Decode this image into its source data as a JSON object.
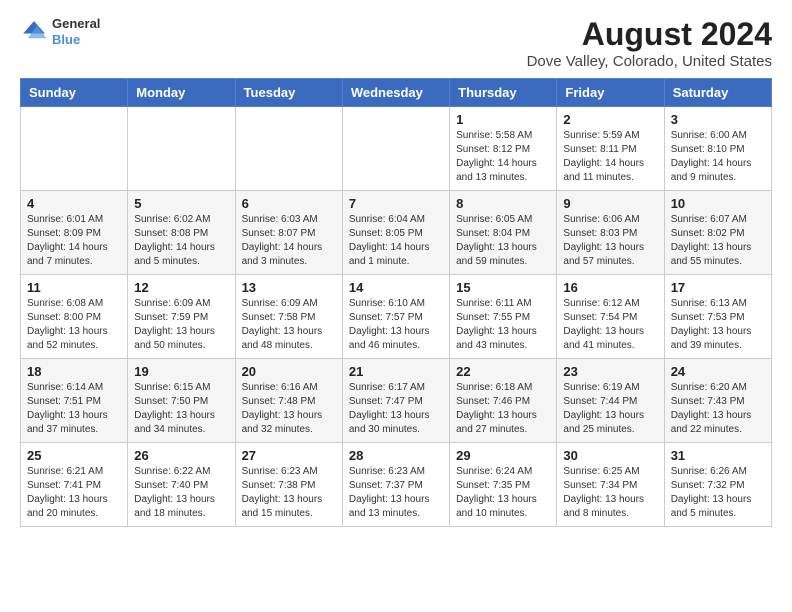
{
  "logo": {
    "general": "General",
    "blue": "Blue"
  },
  "title": "August 2024",
  "subtitle": "Dove Valley, Colorado, United States",
  "days_of_week": [
    "Sunday",
    "Monday",
    "Tuesday",
    "Wednesday",
    "Thursday",
    "Friday",
    "Saturday"
  ],
  "weeks": [
    [
      {
        "day": "",
        "content": ""
      },
      {
        "day": "",
        "content": ""
      },
      {
        "day": "",
        "content": ""
      },
      {
        "day": "",
        "content": ""
      },
      {
        "day": "1",
        "content": "Sunrise: 5:58 AM\nSunset: 8:12 PM\nDaylight: 14 hours and 13 minutes."
      },
      {
        "day": "2",
        "content": "Sunrise: 5:59 AM\nSunset: 8:11 PM\nDaylight: 14 hours and 11 minutes."
      },
      {
        "day": "3",
        "content": "Sunrise: 6:00 AM\nSunset: 8:10 PM\nDaylight: 14 hours and 9 minutes."
      }
    ],
    [
      {
        "day": "4",
        "content": "Sunrise: 6:01 AM\nSunset: 8:09 PM\nDaylight: 14 hours and 7 minutes."
      },
      {
        "day": "5",
        "content": "Sunrise: 6:02 AM\nSunset: 8:08 PM\nDaylight: 14 hours and 5 minutes."
      },
      {
        "day": "6",
        "content": "Sunrise: 6:03 AM\nSunset: 8:07 PM\nDaylight: 14 hours and 3 minutes."
      },
      {
        "day": "7",
        "content": "Sunrise: 6:04 AM\nSunset: 8:05 PM\nDaylight: 14 hours and 1 minute."
      },
      {
        "day": "8",
        "content": "Sunrise: 6:05 AM\nSunset: 8:04 PM\nDaylight: 13 hours and 59 minutes."
      },
      {
        "day": "9",
        "content": "Sunrise: 6:06 AM\nSunset: 8:03 PM\nDaylight: 13 hours and 57 minutes."
      },
      {
        "day": "10",
        "content": "Sunrise: 6:07 AM\nSunset: 8:02 PM\nDaylight: 13 hours and 55 minutes."
      }
    ],
    [
      {
        "day": "11",
        "content": "Sunrise: 6:08 AM\nSunset: 8:00 PM\nDaylight: 13 hours and 52 minutes."
      },
      {
        "day": "12",
        "content": "Sunrise: 6:09 AM\nSunset: 7:59 PM\nDaylight: 13 hours and 50 minutes."
      },
      {
        "day": "13",
        "content": "Sunrise: 6:09 AM\nSunset: 7:58 PM\nDaylight: 13 hours and 48 minutes."
      },
      {
        "day": "14",
        "content": "Sunrise: 6:10 AM\nSunset: 7:57 PM\nDaylight: 13 hours and 46 minutes."
      },
      {
        "day": "15",
        "content": "Sunrise: 6:11 AM\nSunset: 7:55 PM\nDaylight: 13 hours and 43 minutes."
      },
      {
        "day": "16",
        "content": "Sunrise: 6:12 AM\nSunset: 7:54 PM\nDaylight: 13 hours and 41 minutes."
      },
      {
        "day": "17",
        "content": "Sunrise: 6:13 AM\nSunset: 7:53 PM\nDaylight: 13 hours and 39 minutes."
      }
    ],
    [
      {
        "day": "18",
        "content": "Sunrise: 6:14 AM\nSunset: 7:51 PM\nDaylight: 13 hours and 37 minutes."
      },
      {
        "day": "19",
        "content": "Sunrise: 6:15 AM\nSunset: 7:50 PM\nDaylight: 13 hours and 34 minutes."
      },
      {
        "day": "20",
        "content": "Sunrise: 6:16 AM\nSunset: 7:48 PM\nDaylight: 13 hours and 32 minutes."
      },
      {
        "day": "21",
        "content": "Sunrise: 6:17 AM\nSunset: 7:47 PM\nDaylight: 13 hours and 30 minutes."
      },
      {
        "day": "22",
        "content": "Sunrise: 6:18 AM\nSunset: 7:46 PM\nDaylight: 13 hours and 27 minutes."
      },
      {
        "day": "23",
        "content": "Sunrise: 6:19 AM\nSunset: 7:44 PM\nDaylight: 13 hours and 25 minutes."
      },
      {
        "day": "24",
        "content": "Sunrise: 6:20 AM\nSunset: 7:43 PM\nDaylight: 13 hours and 22 minutes."
      }
    ],
    [
      {
        "day": "25",
        "content": "Sunrise: 6:21 AM\nSunset: 7:41 PM\nDaylight: 13 hours and 20 minutes."
      },
      {
        "day": "26",
        "content": "Sunrise: 6:22 AM\nSunset: 7:40 PM\nDaylight: 13 hours and 18 minutes."
      },
      {
        "day": "27",
        "content": "Sunrise: 6:23 AM\nSunset: 7:38 PM\nDaylight: 13 hours and 15 minutes."
      },
      {
        "day": "28",
        "content": "Sunrise: 6:23 AM\nSunset: 7:37 PM\nDaylight: 13 hours and 13 minutes."
      },
      {
        "day": "29",
        "content": "Sunrise: 6:24 AM\nSunset: 7:35 PM\nDaylight: 13 hours and 10 minutes."
      },
      {
        "day": "30",
        "content": "Sunrise: 6:25 AM\nSunset: 7:34 PM\nDaylight: 13 hours and 8 minutes."
      },
      {
        "day": "31",
        "content": "Sunrise: 6:26 AM\nSunset: 7:32 PM\nDaylight: 13 hours and 5 minutes."
      }
    ]
  ]
}
